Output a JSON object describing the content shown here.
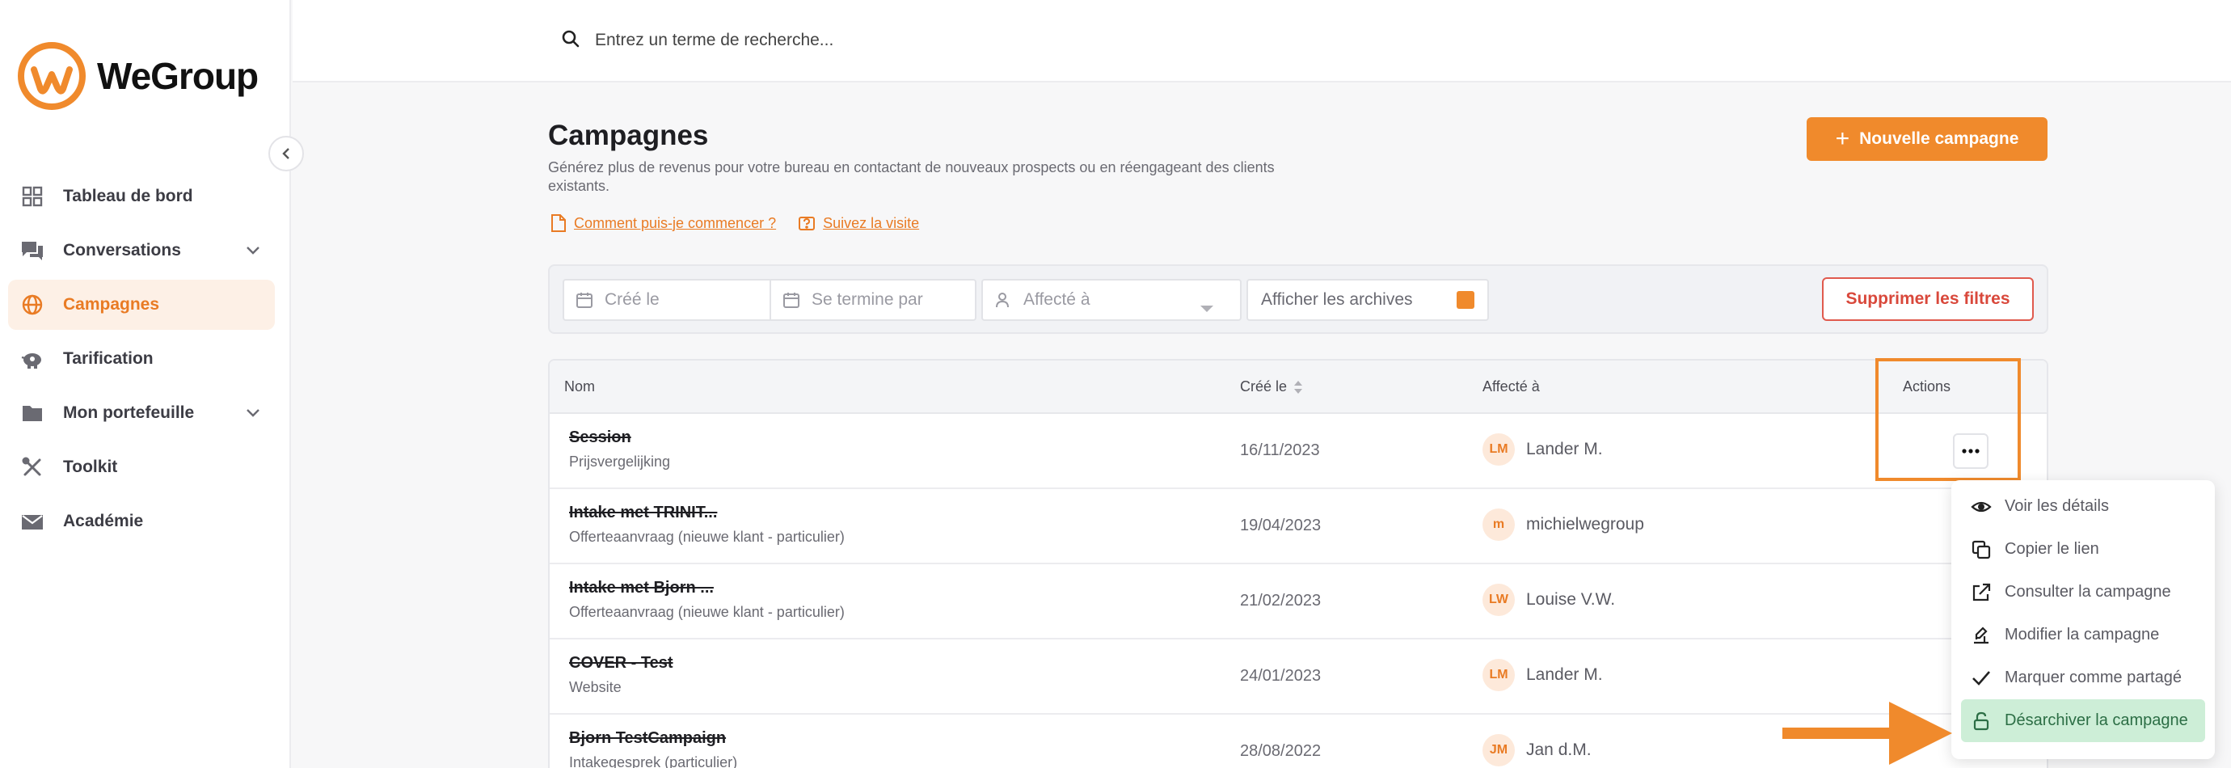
{
  "app": {
    "brand": "WeGroup",
    "brand_color": "#f08a2c"
  },
  "sidebar": {
    "items": [
      {
        "label": "Tableau de bord",
        "icon": "dashboard-icon"
      },
      {
        "label": "Conversations",
        "icon": "chat-icon",
        "expandable": true
      },
      {
        "label": "Campagnes",
        "icon": "globe-icon",
        "active": true
      },
      {
        "label": "Tarification",
        "icon": "piggy-bank-icon"
      },
      {
        "label": "Mon portefeuille",
        "icon": "folder-icon",
        "expandable": true
      },
      {
        "label": "Toolkit",
        "icon": "tools-icon"
      },
      {
        "label": "Académie",
        "icon": "mail-icon"
      }
    ]
  },
  "search": {
    "placeholder": "Entrez un terme de recherche..."
  },
  "header": {
    "title": "Campagnes",
    "description": "Générez plus de revenus pour votre bureau en contactant de nouveaux prospects ou en réengageant des clients existants.",
    "help_link": "Comment puis-je commencer ?",
    "tour_link": "Suivez la visite",
    "new_button": "Nouvelle campagne"
  },
  "filters": {
    "created_placeholder": "Créé le",
    "ends_placeholder": "Se termine par",
    "assigned_placeholder": "Affecté à",
    "archives_label": "Afficher les archives",
    "archives_checked": true,
    "clear_button": "Supprimer les filtres"
  },
  "table": {
    "columns": {
      "name": "Nom",
      "created": "Créé le",
      "assigned": "Affecté à",
      "actions": "Actions"
    },
    "rows": [
      {
        "name": "Session",
        "subtitle": "Prijsvergelijking",
        "created": "16/11/2023",
        "initials": "LM",
        "assignee": "Lander M."
      },
      {
        "name": "Intake met TRINIT...",
        "subtitle": "Offerteaanvraag (nieuwe klant - particulier)",
        "created": "19/04/2023",
        "initials": "m",
        "assignee": "michielwegroup"
      },
      {
        "name": "Intake met Bjorn ...",
        "subtitle": "Offerteaanvraag (nieuwe klant - particulier)",
        "created": "21/02/2023",
        "initials": "LW",
        "assignee": "Louise V.W."
      },
      {
        "name": "COVER - Test",
        "subtitle": "Website",
        "created": "24/01/2023",
        "initials": "LM",
        "assignee": "Lander M."
      },
      {
        "name": "Bjorn TestCampaign",
        "subtitle": "Intakegesprek (particulier)",
        "created": "28/08/2022",
        "initials": "JM",
        "assignee": "Jan d.M."
      }
    ]
  },
  "actions_menu": {
    "items": [
      {
        "label": "Voir les détails",
        "icon": "eye-icon"
      },
      {
        "label": "Copier le lien",
        "icon": "copy-icon"
      },
      {
        "label": "Consulter la campagne",
        "icon": "external-link-icon"
      },
      {
        "label": "Modifier la campagne",
        "icon": "edit-icon"
      },
      {
        "label": "Marquer comme partagé",
        "icon": "check-icon"
      },
      {
        "label": "Désarchiver la campagne",
        "icon": "unlock-icon",
        "highlighted": true
      }
    ]
  }
}
